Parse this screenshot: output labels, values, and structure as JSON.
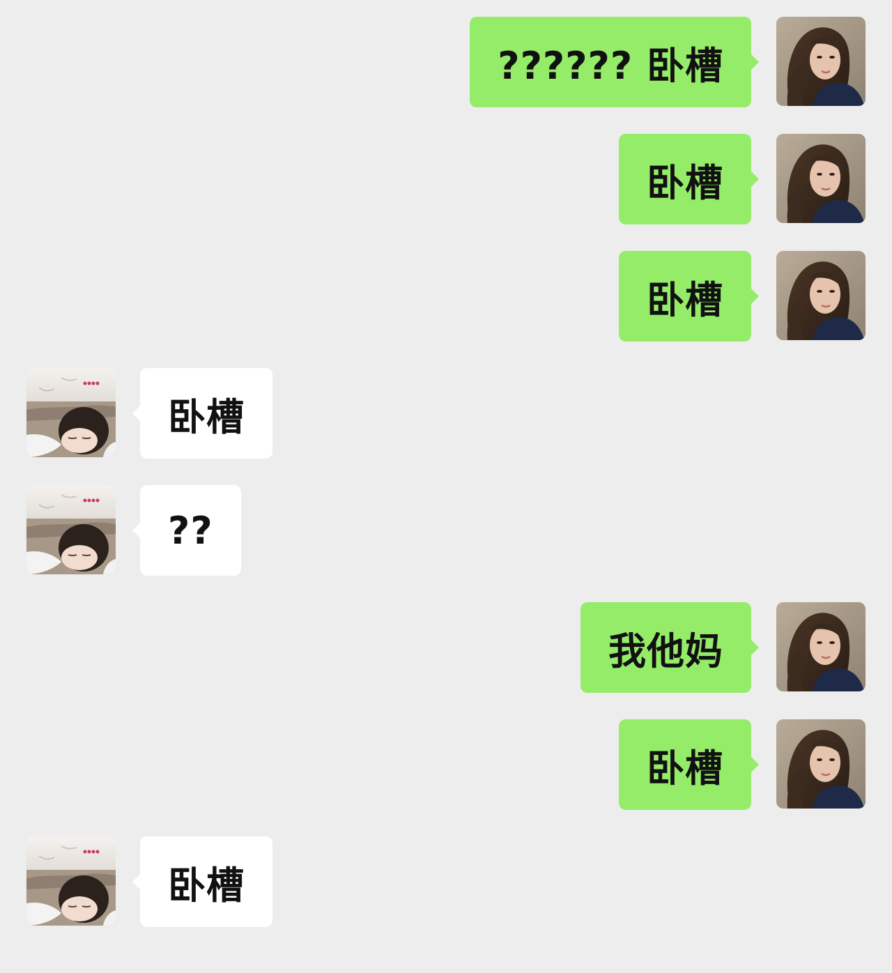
{
  "conversation": {
    "messages": [
      {
        "side": "out",
        "text": "?????? 卧槽",
        "avatar": "self-avatar"
      },
      {
        "side": "out",
        "text": "卧槽",
        "avatar": "self-avatar"
      },
      {
        "side": "out",
        "text": "卧槽",
        "avatar": "self-avatar"
      },
      {
        "side": "in",
        "text": "卧槽",
        "avatar": "contact-avatar"
      },
      {
        "side": "in",
        "text": "??",
        "avatar": "contact-avatar"
      },
      {
        "side": "out",
        "text": "我他妈",
        "avatar": "self-avatar"
      },
      {
        "side": "out",
        "text": "卧槽",
        "avatar": "self-avatar"
      },
      {
        "side": "in",
        "text": "卧槽",
        "avatar": "contact-avatar"
      }
    ]
  },
  "colors": {
    "background": "#ededed",
    "outgoing_bubble": "#95ec69",
    "incoming_bubble": "#ffffff",
    "text": "#111111"
  }
}
